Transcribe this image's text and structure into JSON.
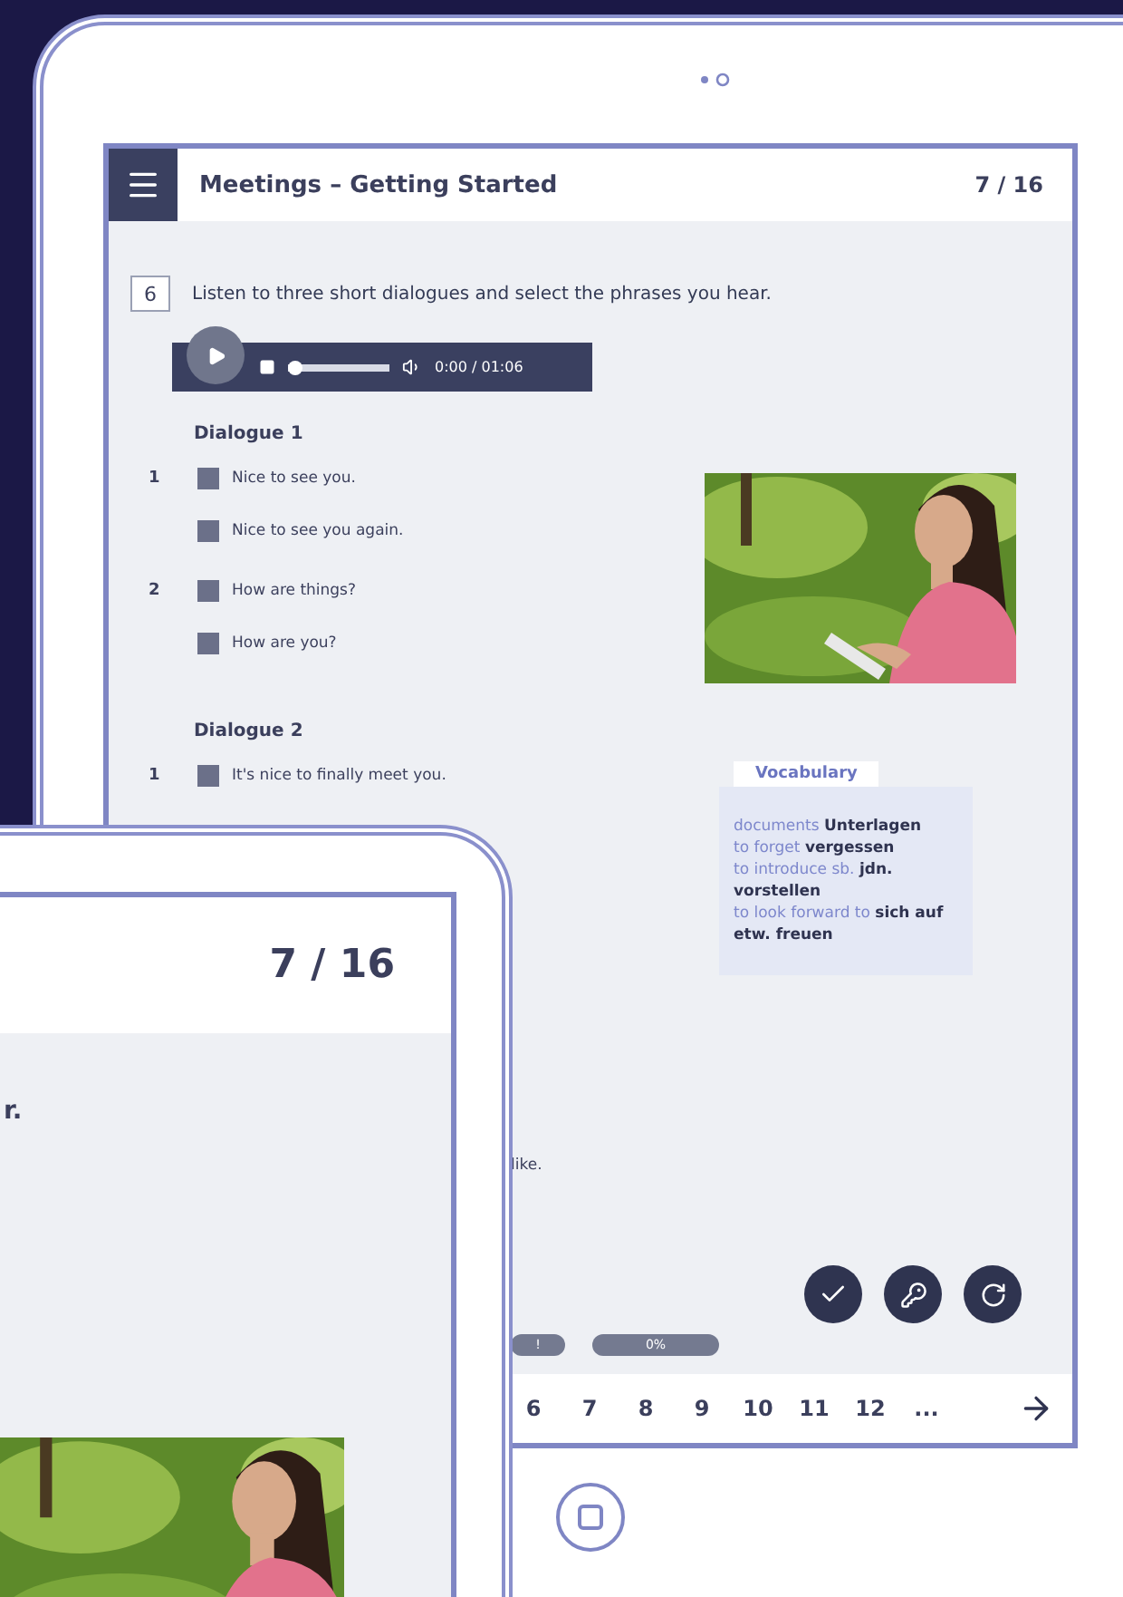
{
  "back_tablet": {
    "header": {
      "title": "Meetings – Getting Started",
      "page": "7 / 16"
    },
    "exercise": {
      "number": "6",
      "instruction": "Listen to three short dialogues and select the phrases you hear."
    },
    "audio_player": {
      "time": "0:00 / 01:06",
      "level": 0
    },
    "dialogues": [
      {
        "title": "Dialogue 1",
        "items": [
          {
            "number": "1",
            "text": "Nice to see you.",
            "checked": false
          },
          {
            "text": "Nice to see you again.",
            "checked": false
          },
          {
            "number": "2",
            "text": "How are things?",
            "checked": false
          },
          {
            "text": "How are you?",
            "checked": false
          }
        ]
      },
      {
        "title": "Dialogue 2",
        "items": [
          {
            "number": "1",
            "text": "It's nice to finally meet you.",
            "checked": false
          }
        ]
      }
    ],
    "vocabulary": {
      "title": "Vocabulary",
      "entries": [
        {
          "term": "documents",
          "translation": "Unterlagen"
        },
        {
          "term": "to forget",
          "translation": "vergessen"
        },
        {
          "term": "to introduce sb.",
          "translation": "jdn. vorstellen"
        },
        {
          "term": "to look forward to",
          "translation": "sich auf etw. freuen"
        }
      ]
    },
    "partial_text": "like.",
    "actions": [
      {
        "kind": "check"
      },
      {
        "kind": "solution"
      },
      {
        "kind": "reset"
      }
    ],
    "progress": [
      {
        "label": "!"
      },
      {
        "label": "0%"
      }
    ],
    "pagination": {
      "pages": [
        "6",
        "7",
        "8",
        "9",
        "10",
        "11",
        "12",
        "..."
      ]
    }
  },
  "front_tablet": {
    "header": {
      "page": "7 / 16"
    },
    "partial_text": "r."
  }
}
